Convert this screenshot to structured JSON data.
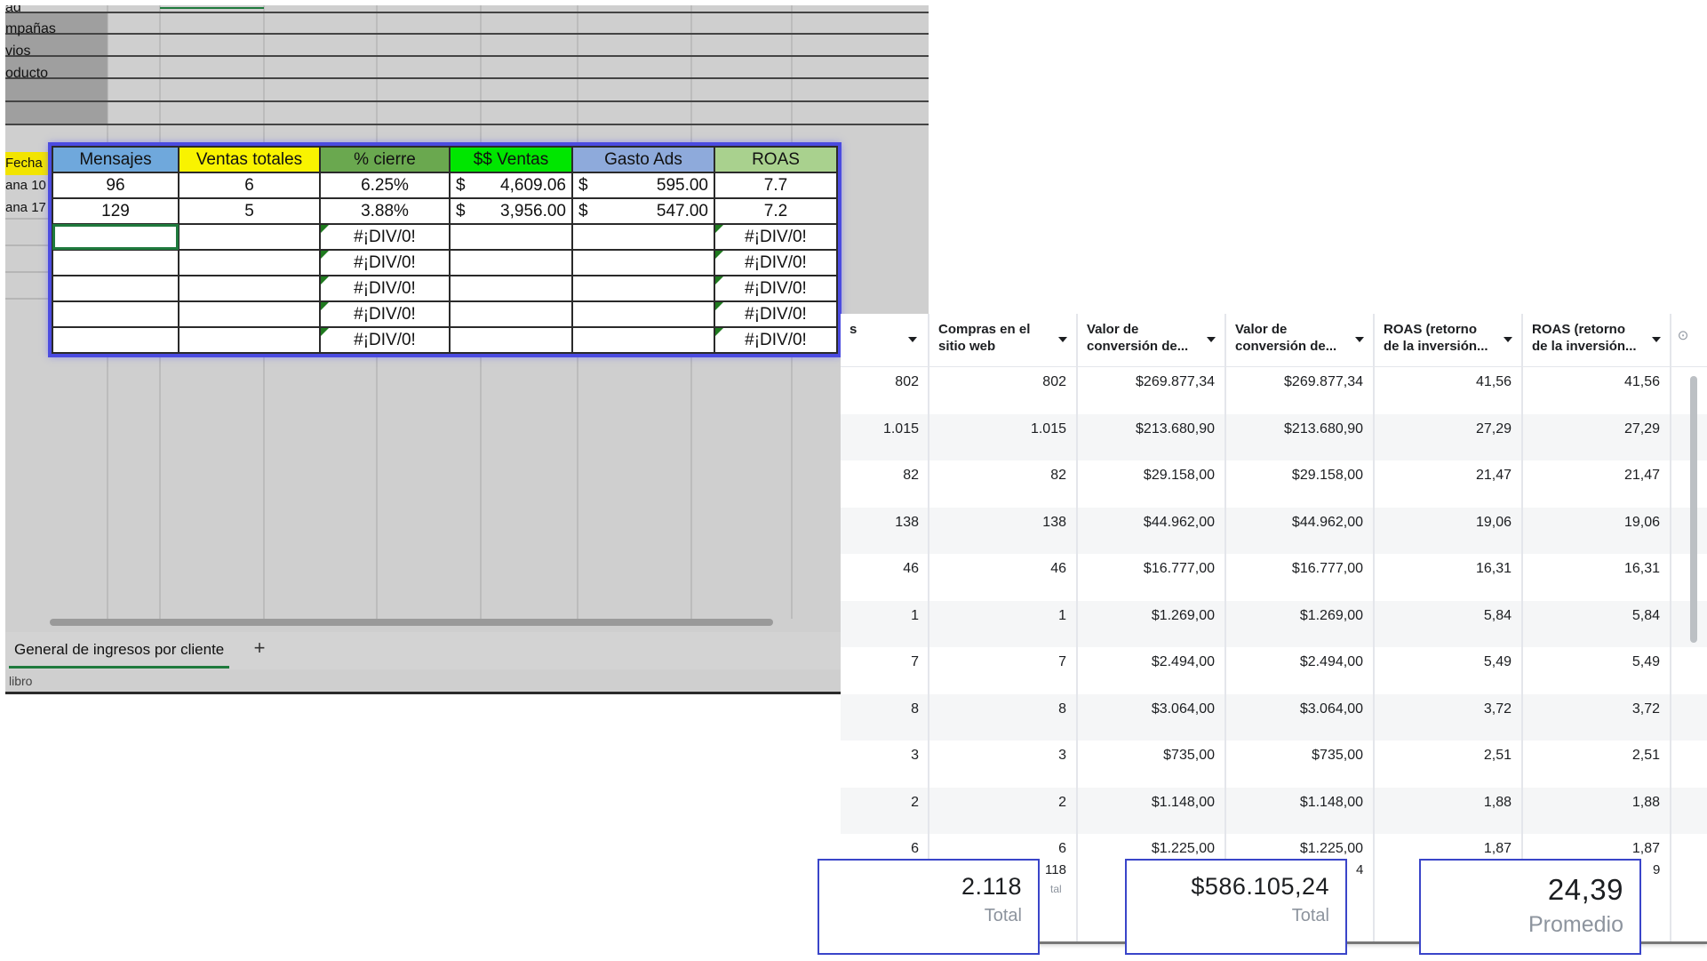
{
  "sheet": {
    "top_labels": [
      "ad",
      "mpañas",
      "vios",
      "oducto"
    ],
    "left_labels": [
      "Fecha",
      "ana 10",
      "ana 17"
    ],
    "headers": [
      {
        "label": "Mensajes",
        "color": "#6fa8dc"
      },
      {
        "label": "Ventas totales",
        "color": "#f9f300"
      },
      {
        "label": "% cierre",
        "color": "#6aa84f"
      },
      {
        "label": "$$ Ventas",
        "color": "#00e600"
      },
      {
        "label": "Gasto Ads",
        "color": "#8eaadb"
      },
      {
        "label": "ROAS",
        "color": "#a9d18e"
      }
    ],
    "rows": [
      {
        "mensajes": "96",
        "ventas": "6",
        "cierre": "6.25%",
        "ventas_cur": "$",
        "ventas_amt": "4,609.06",
        "gasto_cur": "$",
        "gasto_amt": "595.00",
        "roas": "7.7"
      },
      {
        "mensajes": "129",
        "ventas": "5",
        "cierre": "3.88%",
        "ventas_cur": "$",
        "ventas_amt": "3,956.00",
        "gasto_cur": "$",
        "gasto_amt": "547.00",
        "roas": "7.2"
      }
    ],
    "error_rows": [
      "#¡DIV/0!",
      "#¡DIV/0!",
      "#¡DIV/0!",
      "#¡DIV/0!",
      "#¡DIV/0!"
    ],
    "sheet_tab": "General de ingresos por cliente",
    "add_tab": "+",
    "status": "libro"
  },
  "ads": {
    "headers": [
      "s",
      "Compras en el\nsitio web",
      "Valor de\nconversión de...",
      "Valor de\nconversión de...",
      "ROAS (retorno\nde la inversión...",
      "ROAS (retorno\nde la inversión..."
    ],
    "settings_icon": "⊙",
    "rows": [
      [
        "802",
        "802",
        "$269.877,34",
        "$269.877,34",
        "41,56",
        "41,56"
      ],
      [
        "1.015",
        "1.015",
        "$213.680,90",
        "$213.680,90",
        "27,29",
        "27,29"
      ],
      [
        "82",
        "82",
        "$29.158,00",
        "$29.158,00",
        "21,47",
        "21,47"
      ],
      [
        "138",
        "138",
        "$44.962,00",
        "$44.962,00",
        "19,06",
        "19,06"
      ],
      [
        "46",
        "46",
        "$16.777,00",
        "$16.777,00",
        "16,31",
        "16,31"
      ],
      [
        "1",
        "1",
        "$1.269,00",
        "$1.269,00",
        "5,84",
        "5,84"
      ],
      [
        "7",
        "7",
        "$2.494,00",
        "$2.494,00",
        "5,49",
        "5,49"
      ],
      [
        "8",
        "8",
        "$3.064,00",
        "$3.064,00",
        "3,72",
        "3,72"
      ],
      [
        "3",
        "3",
        "$735,00",
        "$735,00",
        "2,51",
        "2,51"
      ],
      [
        "2",
        "2",
        "$1.148,00",
        "$1.148,00",
        "1,88",
        "1,88"
      ],
      [
        "6",
        "6",
        "$1.225,00",
        "$1.225,00",
        "1,87",
        "1,87"
      ]
    ],
    "footer_ghosts": [
      "118",
      "tal",
      "4",
      "9"
    ]
  },
  "summary": [
    {
      "value": "2.118",
      "label": "Total"
    },
    {
      "value": "$586.105,24",
      "label": "Total"
    },
    {
      "value": "24,39",
      "label": "Promedio"
    }
  ]
}
